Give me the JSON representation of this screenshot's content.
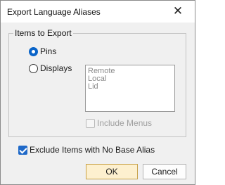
{
  "window": {
    "title": "Export Language Aliases",
    "close_glyph": "✕"
  },
  "items_group": {
    "legend": "Items to Export",
    "options": [
      {
        "label": "Pins",
        "selected": true
      },
      {
        "label": "Displays",
        "selected": false
      }
    ],
    "displays_list": [
      "Remote",
      "Local",
      "Lid"
    ],
    "include_menus": {
      "label": "Include Menus",
      "checked": false,
      "enabled": false
    }
  },
  "exclude_option": {
    "label": "Exclude Items with No Base Alias",
    "checked": true
  },
  "buttons": {
    "ok": "OK",
    "cancel": "Cancel"
  },
  "colors": {
    "accent": "#0a64c8",
    "ok_button_bg": "#fdf0cf",
    "dialog_bg": "#f0f0f0"
  }
}
